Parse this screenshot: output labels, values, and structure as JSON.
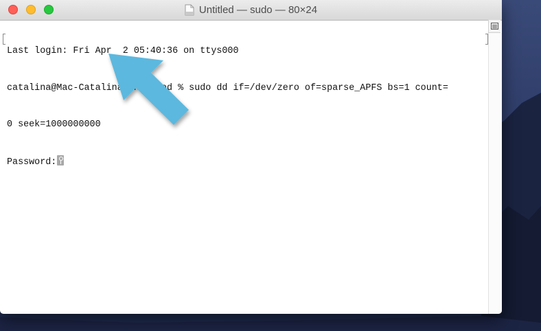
{
  "window": {
    "title": "Untitled — sudo — 80×24"
  },
  "terminal": {
    "lines": [
      "Last login: Fri Apr  2 05:40:36 on ttys000",
      "catalina@Mac-Catalina Untitled % sudo dd if=/dev/zero of=sparse_APFS bs=1 count=",
      "0 seek=1000000000",
      "Password:"
    ]
  },
  "colors": {
    "arrow": "#5bb8de",
    "close": "#fe5f57",
    "minimize": "#febc2e",
    "zoom": "#28c840"
  },
  "icons": {
    "document": "document-icon",
    "scroll_toggle": "list-icon",
    "password_cursor": "key-icon"
  }
}
